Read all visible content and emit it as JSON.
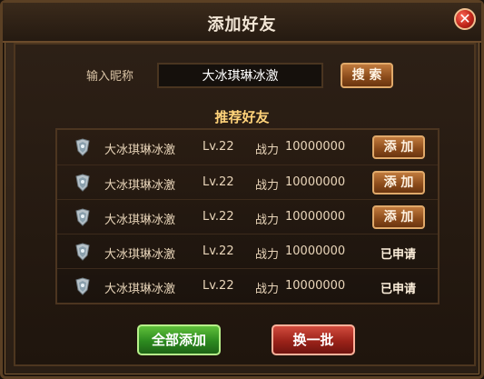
{
  "dialog": {
    "title": "添加好友",
    "close_icon": "close-icon"
  },
  "search": {
    "label": "输入昵称",
    "value": "大冰琪琳冰激",
    "button_label": "搜 索"
  },
  "recommend": {
    "title": "推荐好友",
    "power_label": "战力",
    "rows": [
      {
        "name": "大冰琪琳冰激",
        "level": "Lv.22",
        "power": "10000000",
        "action": "添 加",
        "state": "add"
      },
      {
        "name": "大冰琪琳冰激",
        "level": "Lv.22",
        "power": "10000000",
        "action": "添 加",
        "state": "add"
      },
      {
        "name": "大冰琪琳冰激",
        "level": "Lv.22",
        "power": "10000000",
        "action": "添 加",
        "state": "add"
      },
      {
        "name": "大冰琪琳冰激",
        "level": "Lv.22",
        "power": "10000000",
        "action": "已申请",
        "state": "applied"
      },
      {
        "name": "大冰琪琳冰激",
        "level": "Lv.22",
        "power": "10000000",
        "action": "已申请",
        "state": "applied"
      }
    ]
  },
  "footer": {
    "add_all_label": "全部添加",
    "refresh_label": "换一批"
  },
  "colors": {
    "title_text": "#f2e6d6",
    "section_title": "#ffd37a",
    "add_all_button": "#2c8a1f",
    "refresh_button": "#9b2219",
    "row_button": "#8a4a1a"
  },
  "icons": {
    "row_icon": "rank-badge-icon"
  }
}
